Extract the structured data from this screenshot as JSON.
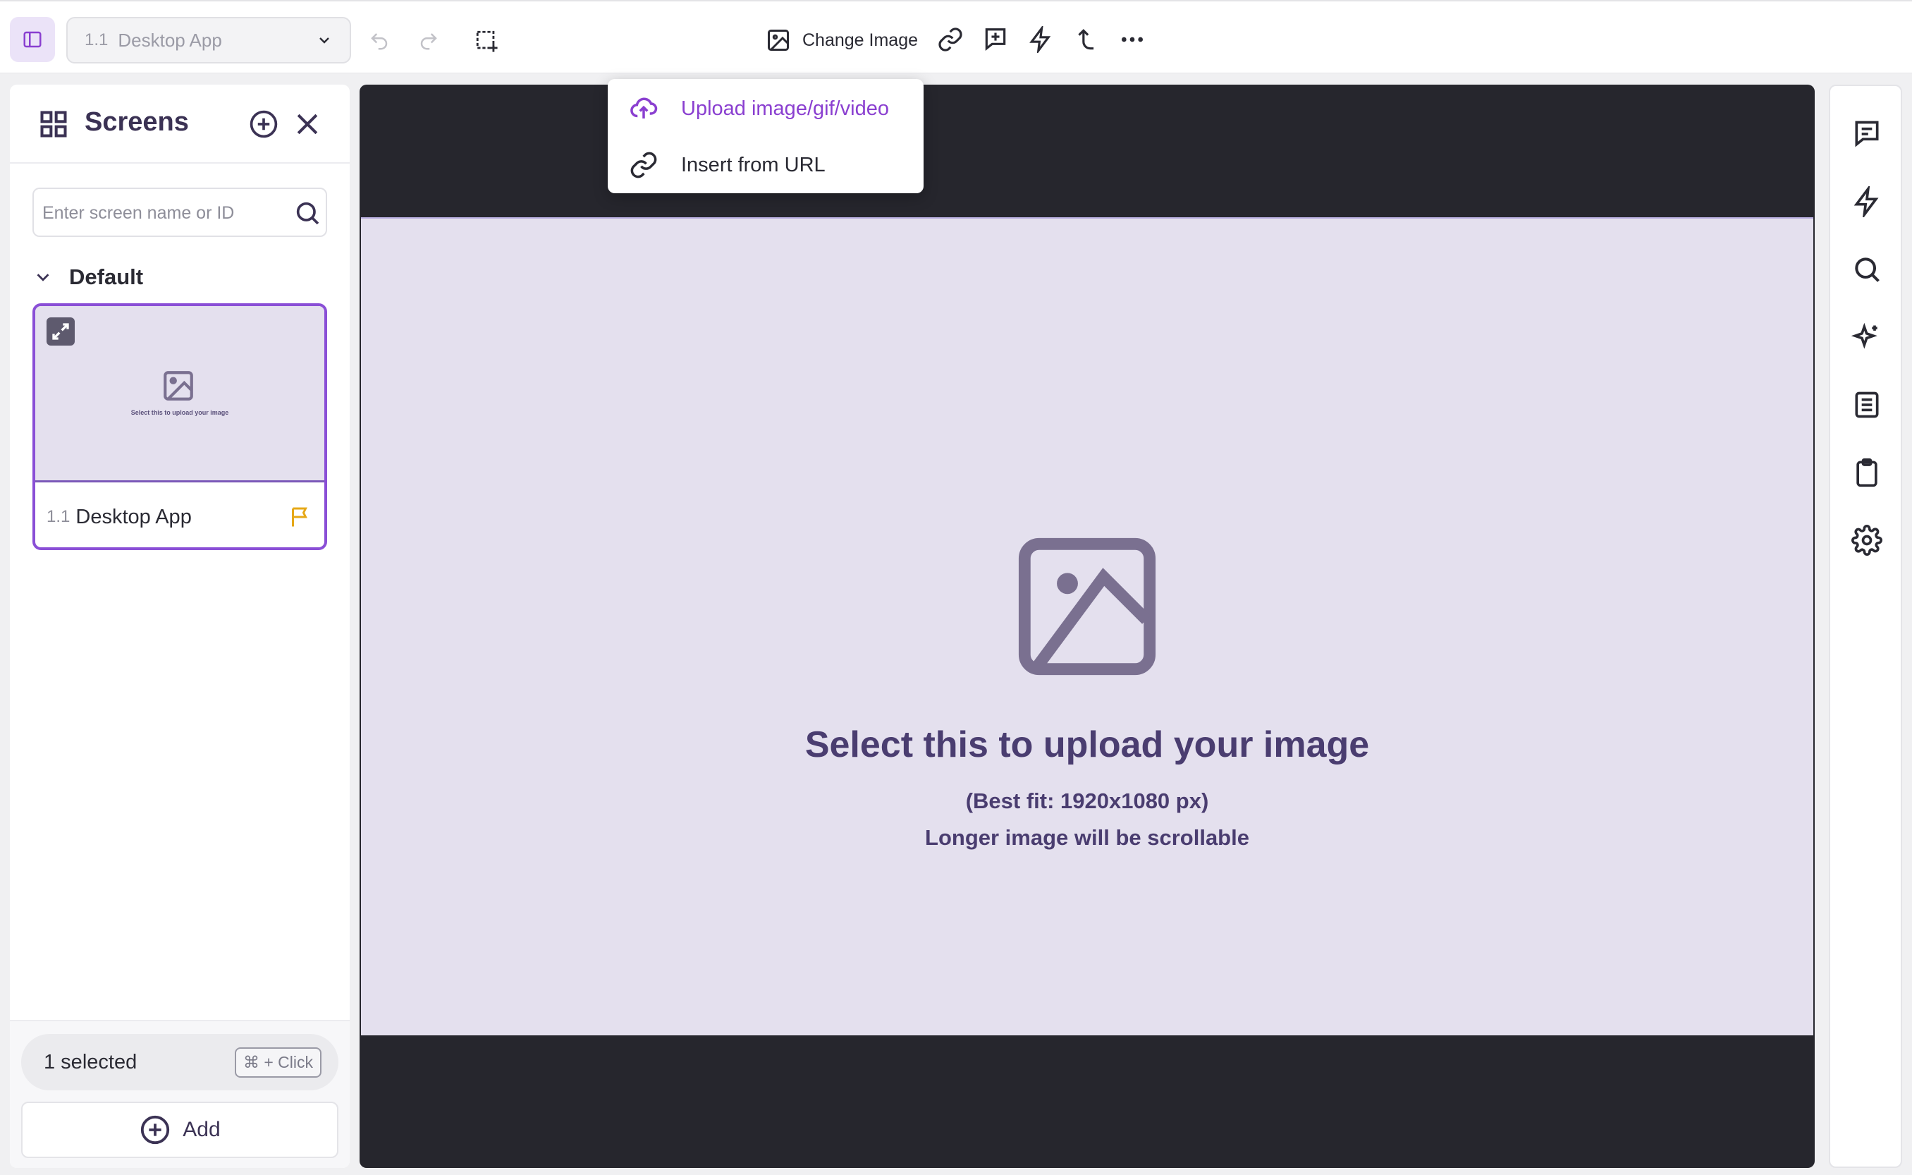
{
  "toolbar": {
    "screen_number": "1.1",
    "screen_name": "Desktop App",
    "change_image_label": "Change Image"
  },
  "dropdown": {
    "upload_label": "Upload image/gif/video",
    "url_label": "Insert from URL"
  },
  "sidebar": {
    "title": "Screens",
    "search_placeholder": "Enter screen name or ID",
    "group_label": "Default",
    "screens": [
      {
        "number": "1.1",
        "name": "Desktop App",
        "thumb_text": "Select this to upload your image"
      }
    ],
    "selected_text": "1 selected",
    "shortcut_hint": "⌘ + Click",
    "add_label": "Add"
  },
  "canvas": {
    "upload_title": "Select this to upload your image",
    "best_fit": "(Best fit: 1920x1080 px)",
    "scroll_note": "Longer image will be scrollable"
  },
  "colors": {
    "accent": "#8a3fd0",
    "canvas_bg": "#26262d",
    "upload_area_bg": "#e4e0ee",
    "flag": "#e6a817"
  },
  "right_rail_icons": [
    "comments-icon",
    "bolt-icon",
    "search-icon",
    "sparkle-icon",
    "document-icon",
    "clipboard-icon",
    "settings-icon"
  ]
}
